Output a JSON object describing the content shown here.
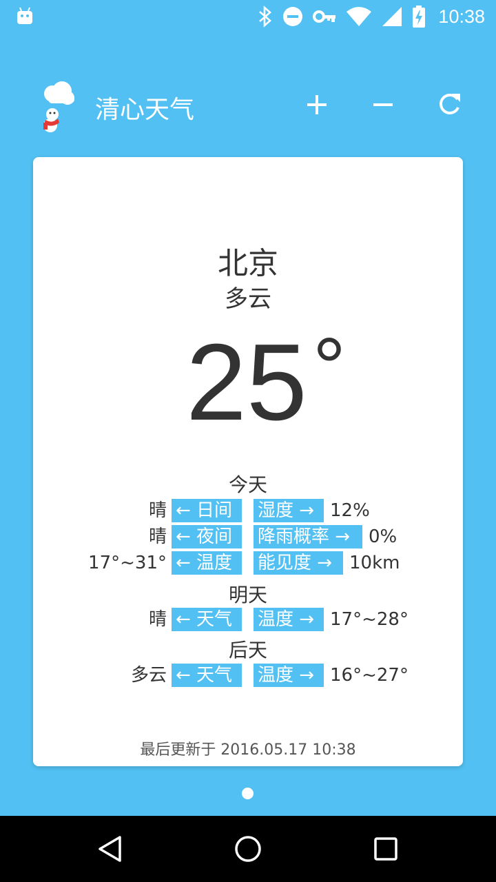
{
  "status_bar": {
    "time": "10:38",
    "icons": [
      "android-icon",
      "bluetooth-icon",
      "dnd-icon",
      "vpn-key-icon",
      "wifi-icon",
      "signal-icon",
      "battery-charging-icon"
    ]
  },
  "app": {
    "title": "清心天气",
    "buttons": {
      "add": "plus-icon",
      "remove": "minus-icon",
      "refresh": "refresh-icon"
    }
  },
  "weather": {
    "city": "北京",
    "condition": "多云",
    "temperature": "25",
    "degree": "°",
    "today": {
      "title": "今天",
      "rows": [
        {
          "left_value": "晴",
          "left_label": "← 日间",
          "right_label": "湿度 →",
          "right_value": "12%"
        },
        {
          "left_value": "晴",
          "left_label": "← 夜间",
          "right_label": "降雨概率 →",
          "right_value": "0%"
        },
        {
          "left_value": "17°~31°",
          "left_label": "← 温度",
          "right_label": "能见度 →",
          "right_value": "10km"
        }
      ]
    },
    "tomorrow": {
      "title": "明天",
      "row": {
        "left_value": "晴",
        "left_label": "← 天气",
        "right_label": "温度 →",
        "right_value": "17°~28°"
      }
    },
    "day_after": {
      "title": "后天",
      "row": {
        "left_value": "多云",
        "left_label": "← 天气",
        "right_label": "温度 →",
        "right_value": "16°~27°"
      }
    },
    "last_updated": "最后更新于 2016.05.17 10:38"
  },
  "pager": {
    "pages": 1,
    "current": 1
  },
  "colors": {
    "background": "#52C0F2",
    "card": "#FFFFFF",
    "label_bg": "#52C0F2",
    "text": "#333333"
  }
}
